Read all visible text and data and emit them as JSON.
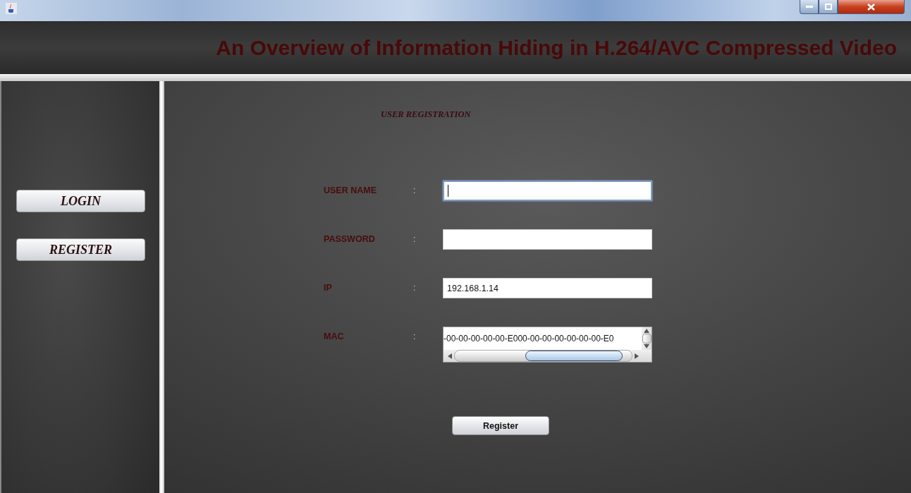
{
  "header": {
    "title": "An Overview of Information Hiding in H.264/AVC Compressed Video"
  },
  "sidebar": {
    "buttons": [
      {
        "label": "LOGIN"
      },
      {
        "label": "REGISTER"
      }
    ]
  },
  "form": {
    "heading": "USER REGISTRATION",
    "fields": [
      {
        "kind": "text",
        "label": "USER NAME",
        "separator": ":",
        "focused": true
      },
      {
        "kind": "text",
        "label": "PASSWORD",
        "separator": ":",
        "focused": false
      },
      {
        "kind": "text",
        "label": "IP",
        "separator": ":",
        "value": "192.168.1.14",
        "focused": false
      },
      {
        "kind": "textarea",
        "label": "MAC",
        "separator": ":",
        "value": "-00-00-00-00-00-E000-00-00-00-00-00-00-E0",
        "focused": false
      }
    ],
    "submit": "Register"
  }
}
